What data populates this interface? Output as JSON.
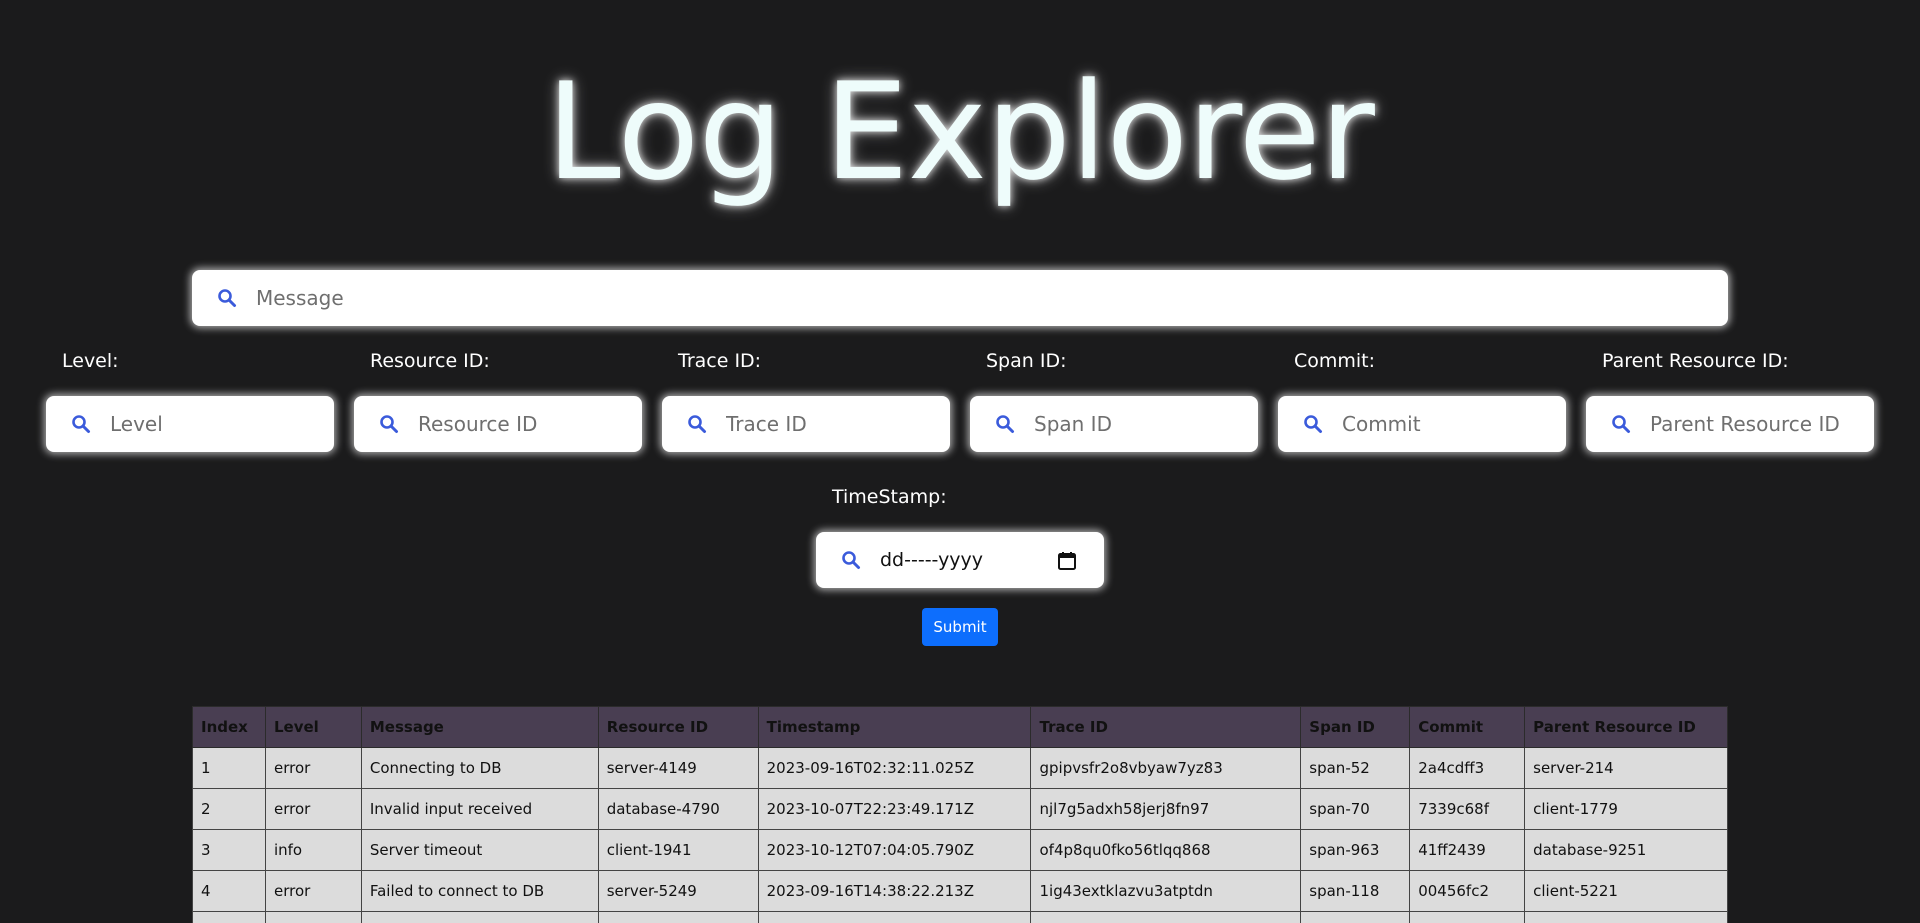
{
  "header": {
    "title": "Log Explorer"
  },
  "search": {
    "message_placeholder": "Message"
  },
  "filters": [
    {
      "label": "Level:",
      "placeholder": "Level"
    },
    {
      "label": "Resource ID:",
      "placeholder": "Resource ID"
    },
    {
      "label": "Trace ID:",
      "placeholder": "Trace ID"
    },
    {
      "label": "Span ID:",
      "placeholder": "Span ID"
    },
    {
      "label": "Commit:",
      "placeholder": "Commit"
    },
    {
      "label": "Parent Resource ID:",
      "placeholder": "Parent Resource ID"
    }
  ],
  "timestamp": {
    "label": "TimeStamp:",
    "value_text": "dd-----yyyy"
  },
  "submit": {
    "label": "Submit"
  },
  "table": {
    "columns": [
      "Index",
      "Level",
      "Message",
      "Resource ID",
      "Timestamp",
      "Trace ID",
      "Span ID",
      "Commit",
      "Parent Resource ID"
    ],
    "rows": [
      [
        "1",
        "error",
        "Connecting to DB",
        "server-4149",
        "2023-09-16T02:32:11.025Z",
        "gpipvsfr2o8vbyaw7yz83",
        "span-52",
        "2a4cdff3",
        "server-214"
      ],
      [
        "2",
        "error",
        "Invalid input received",
        "database-4790",
        "2023-10-07T22:23:49.171Z",
        "njl7g5adxh58jerj8fn97",
        "span-70",
        "7339c68f",
        "client-1779"
      ],
      [
        "3",
        "info",
        "Server timeout",
        "client-1941",
        "2023-10-12T07:04:05.790Z",
        "of4p8qu0fko56tlqq868",
        "span-963",
        "41ff2439",
        "database-9251"
      ],
      [
        "4",
        "error",
        "Failed to connect to DB",
        "server-5249",
        "2023-09-16T14:38:22.213Z",
        "1ig43extklazvu3atptdn",
        "span-118",
        "00456fc2",
        "client-5221"
      ],
      [
        "",
        "",
        "",
        "",
        "",
        "",
        "",
        "",
        ""
      ]
    ]
  },
  "colors": {
    "background": "#1b1b1c",
    "icon": "#3b5bdb",
    "accent": "#0d6efd",
    "table_header": "#493e52",
    "table_cell": "#dcdcdc"
  },
  "icons": {
    "search": "search-icon",
    "calendar": "calendar-icon"
  }
}
